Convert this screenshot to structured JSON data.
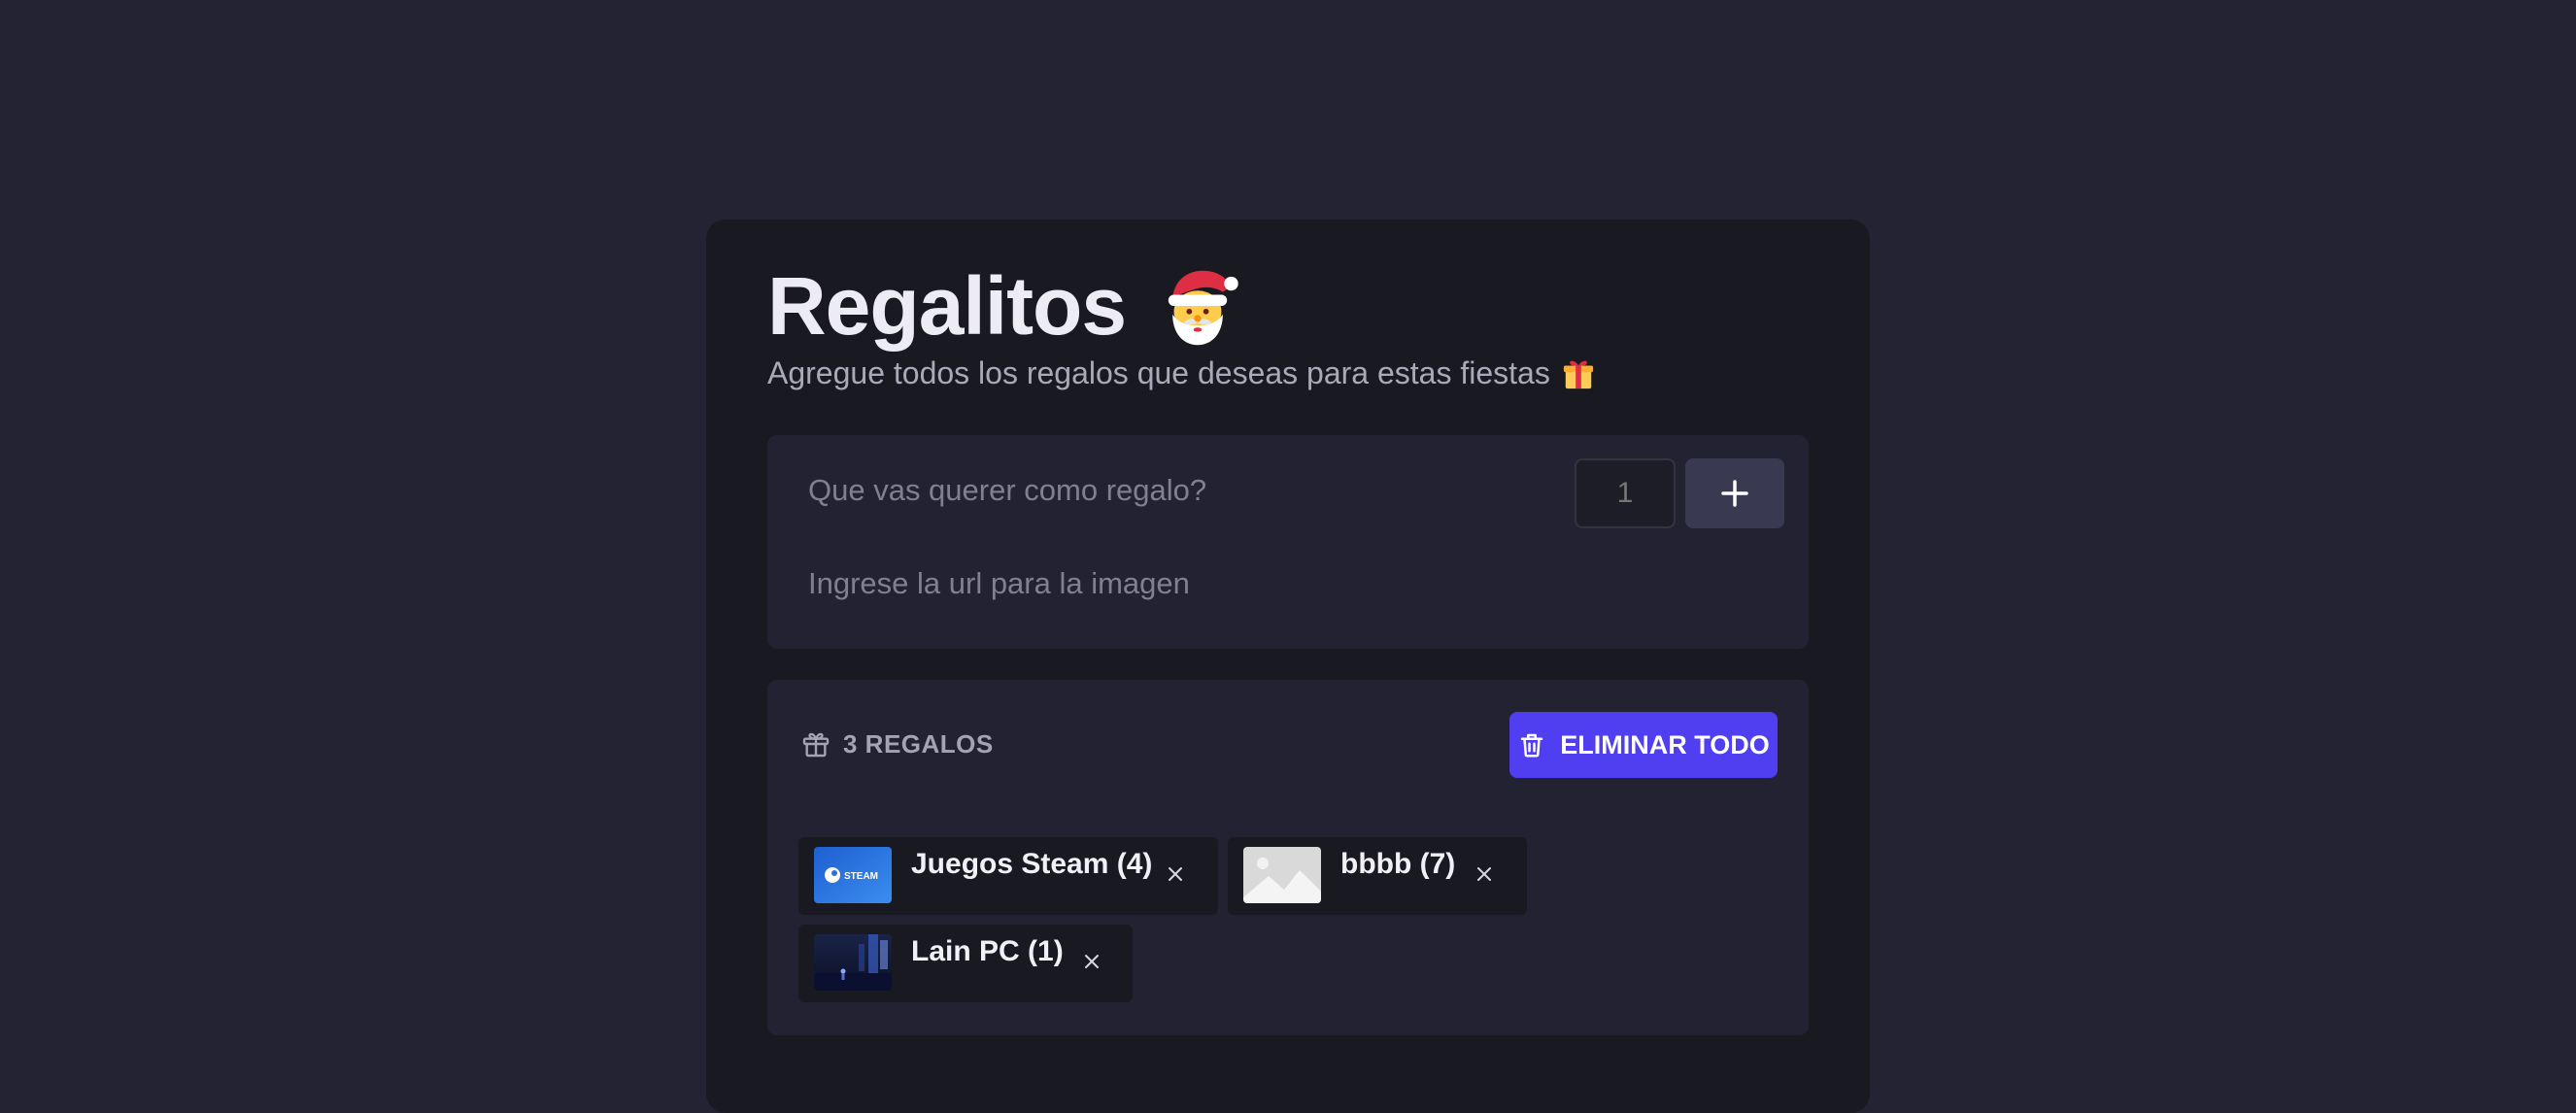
{
  "header": {
    "title": "Regalitos",
    "title_icon": "santa-emoji",
    "subtitle": "Agregue todos los regalos que deseas para estas fiestas",
    "subtitle_icon": "gift-emoji"
  },
  "form": {
    "name_placeholder": "Que vas querer como regalo?",
    "quantity_placeholder": "1",
    "add_icon": "plus-icon",
    "url_placeholder": "Ingrese la url para la imagen"
  },
  "list": {
    "count_label": "3 REGALOS",
    "count_icon": "gift-icon",
    "delete_all_label": "ELIMINAR TODO",
    "delete_all_icon": "trash-icon",
    "items": [
      {
        "label": "Juegos Steam (4)",
        "image": "steam-logo",
        "remove_icon": "close-icon"
      },
      {
        "label": "bbbb (7)",
        "image": "image-placeholder",
        "remove_icon": "close-icon"
      },
      {
        "label": "Lain PC (1)",
        "image": "night-scene",
        "remove_icon": "close-icon"
      }
    ]
  },
  "colors": {
    "background": "#232333",
    "card": "#191921",
    "panel": "#222232",
    "accent": "#4f3ff0"
  }
}
